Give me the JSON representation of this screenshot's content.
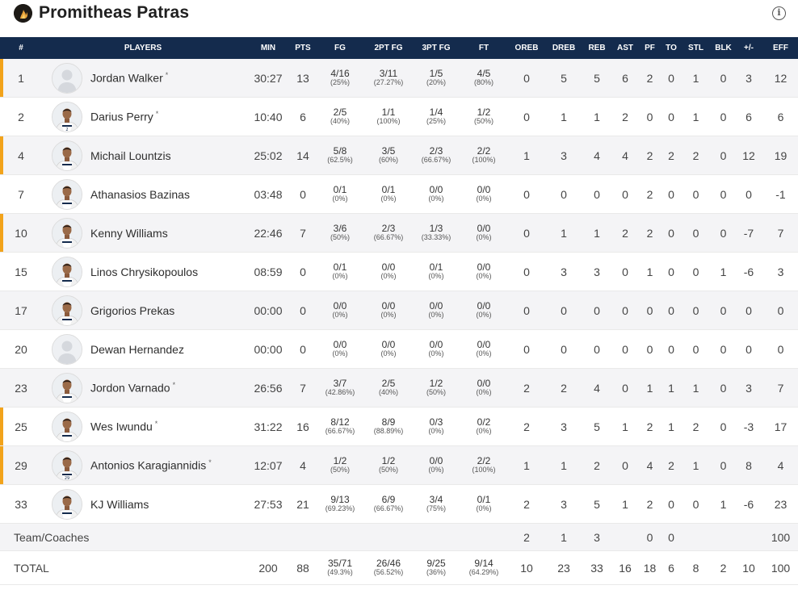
{
  "team": {
    "name": "Promitheas Patras"
  },
  "columns": [
    "#",
    "PLAYERS",
    "MIN",
    "PTS",
    "FG",
    "2PT FG",
    "3PT FG",
    "FT",
    "OREB",
    "DREB",
    "REB",
    "AST",
    "PF",
    "TO",
    "STL",
    "BLK",
    "+/-",
    "EFF"
  ],
  "players": [
    {
      "num": "1",
      "name": "Jordan Walker",
      "star": "*",
      "starter": true,
      "photo": false,
      "jersey": "",
      "min": "30:27",
      "pts": "13",
      "fg": "4/16",
      "fg_pct": "(25%)",
      "p2": "3/11",
      "p2_pct": "(27.27%)",
      "p3": "1/5",
      "p3_pct": "(20%)",
      "ft": "4/5",
      "ft_pct": "(80%)",
      "oreb": "0",
      "dreb": "5",
      "reb": "5",
      "ast": "6",
      "pf": "2",
      "to": "0",
      "stl": "1",
      "blk": "0",
      "pm": "3",
      "eff": "12"
    },
    {
      "num": "2",
      "name": "Darius Perry",
      "star": "*",
      "starter": false,
      "photo": true,
      "jersey": "2",
      "min": "10:40",
      "pts": "6",
      "fg": "2/5",
      "fg_pct": "(40%)",
      "p2": "1/1",
      "p2_pct": "(100%)",
      "p3": "1/4",
      "p3_pct": "(25%)",
      "ft": "1/2",
      "ft_pct": "(50%)",
      "oreb": "0",
      "dreb": "1",
      "reb": "1",
      "ast": "2",
      "pf": "0",
      "to": "0",
      "stl": "1",
      "blk": "0",
      "pm": "6",
      "eff": "6"
    },
    {
      "num": "4",
      "name": "Michail Lountzis",
      "star": "",
      "starter": true,
      "photo": true,
      "jersey": "",
      "min": "25:02",
      "pts": "14",
      "fg": "5/8",
      "fg_pct": "(62.5%)",
      "p2": "3/5",
      "p2_pct": "(60%)",
      "p3": "2/3",
      "p3_pct": "(66.67%)",
      "ft": "2/2",
      "ft_pct": "(100%)",
      "oreb": "1",
      "dreb": "3",
      "reb": "4",
      "ast": "4",
      "pf": "2",
      "to": "2",
      "stl": "2",
      "blk": "0",
      "pm": "12",
      "eff": "19"
    },
    {
      "num": "7",
      "name": "Athanasios Bazinas",
      "star": "",
      "starter": false,
      "photo": true,
      "jersey": "",
      "min": "03:48",
      "pts": "0",
      "fg": "0/1",
      "fg_pct": "(0%)",
      "p2": "0/1",
      "p2_pct": "(0%)",
      "p3": "0/0",
      "p3_pct": "(0%)",
      "ft": "0/0",
      "ft_pct": "(0%)",
      "oreb": "0",
      "dreb": "0",
      "reb": "0",
      "ast": "0",
      "pf": "2",
      "to": "0",
      "stl": "0",
      "blk": "0",
      "pm": "0",
      "eff": "-1"
    },
    {
      "num": "10",
      "name": "Kenny Williams",
      "star": "",
      "starter": true,
      "photo": true,
      "jersey": "",
      "min": "22:46",
      "pts": "7",
      "fg": "3/6",
      "fg_pct": "(50%)",
      "p2": "2/3",
      "p2_pct": "(66.67%)",
      "p3": "1/3",
      "p3_pct": "(33.33%)",
      "ft": "0/0",
      "ft_pct": "(0%)",
      "oreb": "0",
      "dreb": "1",
      "reb": "1",
      "ast": "2",
      "pf": "2",
      "to": "0",
      "stl": "0",
      "blk": "0",
      "pm": "-7",
      "eff": "7"
    },
    {
      "num": "15",
      "name": "Linos Chrysikopoulos",
      "star": "",
      "starter": false,
      "photo": true,
      "jersey": "",
      "min": "08:59",
      "pts": "0",
      "fg": "0/1",
      "fg_pct": "(0%)",
      "p2": "0/0",
      "p2_pct": "(0%)",
      "p3": "0/1",
      "p3_pct": "(0%)",
      "ft": "0/0",
      "ft_pct": "(0%)",
      "oreb": "0",
      "dreb": "3",
      "reb": "3",
      "ast": "0",
      "pf": "1",
      "to": "0",
      "stl": "0",
      "blk": "1",
      "pm": "-6",
      "eff": "3"
    },
    {
      "num": "17",
      "name": "Grigorios Prekas",
      "star": "",
      "starter": false,
      "photo": true,
      "jersey": "",
      "min": "00:00",
      "pts": "0",
      "fg": "0/0",
      "fg_pct": "(0%)",
      "p2": "0/0",
      "p2_pct": "(0%)",
      "p3": "0/0",
      "p3_pct": "(0%)",
      "ft": "0/0",
      "ft_pct": "(0%)",
      "oreb": "0",
      "dreb": "0",
      "reb": "0",
      "ast": "0",
      "pf": "0",
      "to": "0",
      "stl": "0",
      "blk": "0",
      "pm": "0",
      "eff": "0"
    },
    {
      "num": "20",
      "name": "Dewan Hernandez",
      "star": "",
      "starter": false,
      "photo": false,
      "jersey": "",
      "min": "00:00",
      "pts": "0",
      "fg": "0/0",
      "fg_pct": "(0%)",
      "p2": "0/0",
      "p2_pct": "(0%)",
      "p3": "0/0",
      "p3_pct": "(0%)",
      "ft": "0/0",
      "ft_pct": "(0%)",
      "oreb": "0",
      "dreb": "0",
      "reb": "0",
      "ast": "0",
      "pf": "0",
      "to": "0",
      "stl": "0",
      "blk": "0",
      "pm": "0",
      "eff": "0"
    },
    {
      "num": "23",
      "name": "Jordon Varnado",
      "star": "*",
      "starter": false,
      "photo": true,
      "jersey": "",
      "min": "26:56",
      "pts": "7",
      "fg": "3/7",
      "fg_pct": "(42.86%)",
      "p2": "2/5",
      "p2_pct": "(40%)",
      "p3": "1/2",
      "p3_pct": "(50%)",
      "ft": "0/0",
      "ft_pct": "(0%)",
      "oreb": "2",
      "dreb": "2",
      "reb": "4",
      "ast": "0",
      "pf": "1",
      "to": "1",
      "stl": "1",
      "blk": "0",
      "pm": "3",
      "eff": "7"
    },
    {
      "num": "25",
      "name": "Wes Iwundu",
      "star": "*",
      "starter": true,
      "photo": true,
      "jersey": "",
      "min": "31:22",
      "pts": "16",
      "fg": "8/12",
      "fg_pct": "(66.67%)",
      "p2": "8/9",
      "p2_pct": "(88.89%)",
      "p3": "0/3",
      "p3_pct": "(0%)",
      "ft": "0/2",
      "ft_pct": "(0%)",
      "oreb": "2",
      "dreb": "3",
      "reb": "5",
      "ast": "1",
      "pf": "2",
      "to": "1",
      "stl": "2",
      "blk": "0",
      "pm": "-3",
      "eff": "17"
    },
    {
      "num": "29",
      "name": "Antonios Karagiannidis",
      "star": "*",
      "starter": true,
      "photo": true,
      "jersey": "29",
      "min": "12:07",
      "pts": "4",
      "fg": "1/2",
      "fg_pct": "(50%)",
      "p2": "1/2",
      "p2_pct": "(50%)",
      "p3": "0/0",
      "p3_pct": "(0%)",
      "ft": "2/2",
      "ft_pct": "(100%)",
      "oreb": "1",
      "dreb": "1",
      "reb": "2",
      "ast": "0",
      "pf": "4",
      "to": "2",
      "stl": "1",
      "blk": "0",
      "pm": "8",
      "eff": "4"
    },
    {
      "num": "33",
      "name": "KJ Williams",
      "star": "",
      "starter": false,
      "photo": true,
      "jersey": "",
      "min": "27:53",
      "pts": "21",
      "fg": "9/13",
      "fg_pct": "(69.23%)",
      "p2": "6/9",
      "p2_pct": "(66.67%)",
      "p3": "3/4",
      "p3_pct": "(75%)",
      "ft": "0/1",
      "ft_pct": "(0%)",
      "oreb": "2",
      "dreb": "3",
      "reb": "5",
      "ast": "1",
      "pf": "2",
      "to": "0",
      "stl": "0",
      "blk": "1",
      "pm": "-6",
      "eff": "23"
    }
  ],
  "team_row": {
    "label": "Team/Coaches",
    "oreb": "2",
    "dreb": "1",
    "reb": "3",
    "ast": "",
    "pf": "0",
    "to": "0",
    "stl": "",
    "blk": "",
    "pm": "",
    "eff": "100"
  },
  "total_row": {
    "label": "TOTAL",
    "min": "200",
    "pts": "88",
    "fg": "35/71",
    "fg_pct": "(49.3%)",
    "p2": "26/46",
    "p2_pct": "(56.52%)",
    "p3": "9/25",
    "p3_pct": "(36%)",
    "ft": "9/14",
    "ft_pct": "(64.29%)",
    "oreb": "10",
    "dreb": "23",
    "reb": "33",
    "ast": "16",
    "pf": "18",
    "to": "6",
    "stl": "8",
    "blk": "2",
    "pm": "10",
    "eff": "100"
  },
  "colors": {
    "header_bg": "#142b4d",
    "starter_bar": "#f2a31b",
    "row_alt": "#f4f4f6"
  },
  "icons": {
    "info": "info-icon",
    "team_logo": "team-logo-icon"
  }
}
